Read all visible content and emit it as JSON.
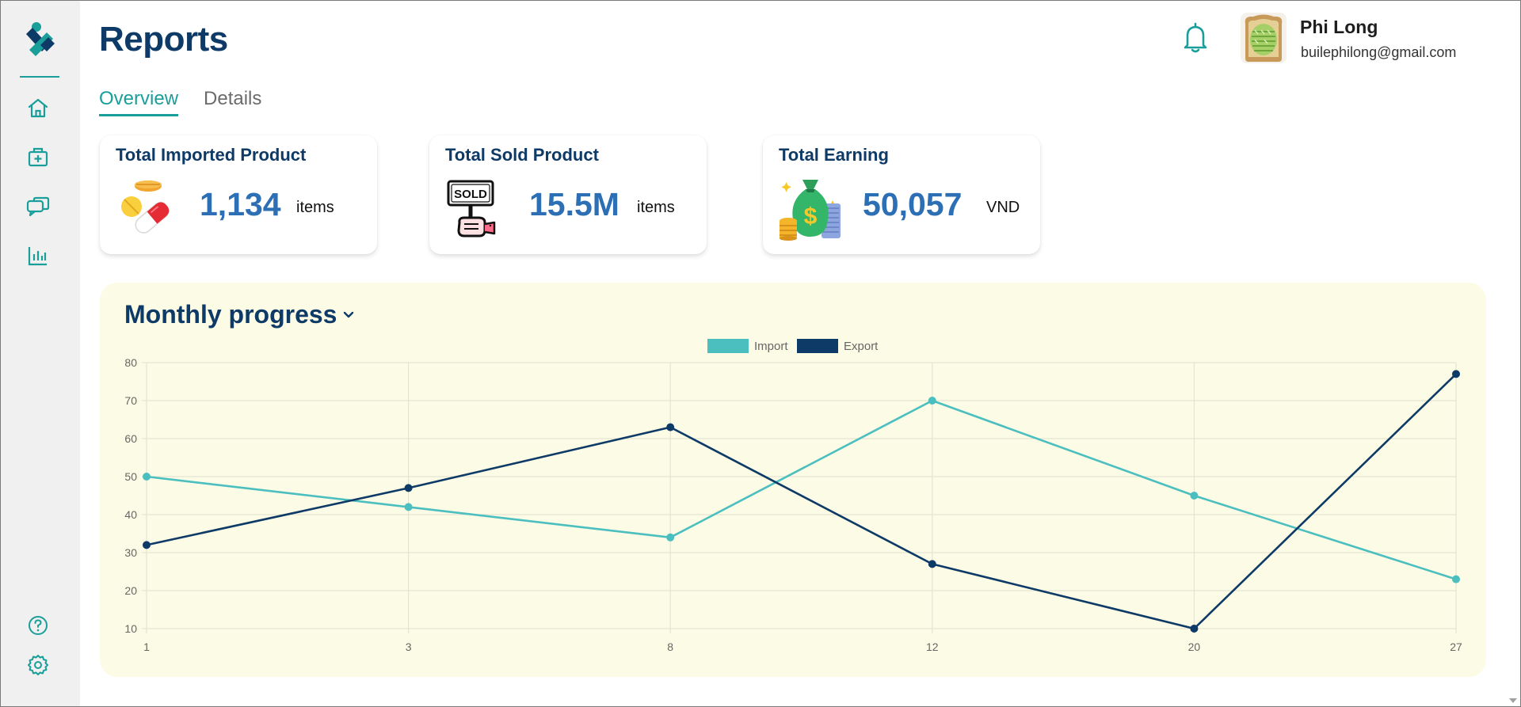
{
  "header": {
    "title": "Reports",
    "tabs": [
      {
        "label": "Overview",
        "active": true
      },
      {
        "label": "Details",
        "active": false
      }
    ],
    "user": {
      "name": "Phi Long",
      "email": "builephilong@gmail.com"
    }
  },
  "sidebar": {
    "items": [
      {
        "icon": "home-icon"
      },
      {
        "icon": "medical-bag-icon"
      },
      {
        "icon": "chat-icon"
      },
      {
        "icon": "bar-chart-icon"
      }
    ],
    "bottom": [
      {
        "icon": "help-icon"
      },
      {
        "icon": "settings-icon"
      }
    ]
  },
  "cards": [
    {
      "title": "Total Imported Product",
      "value": "1,134",
      "unit": "items",
      "icon": "pills-icon"
    },
    {
      "title": "Total Sold Product",
      "value": "15.5M",
      "unit": "items",
      "icon": "sold-sign-icon"
    },
    {
      "title": "Total Earning",
      "value": "50,057",
      "unit": "VND",
      "icon": "money-bag-icon"
    }
  ],
  "panel": {
    "title": "Monthly progress"
  },
  "colors": {
    "accent": "#1a9e9a",
    "navy": "#0d3a66",
    "import": "#4bbfbf",
    "export": "#0d3a66",
    "panel_bg": "#fcfbe5"
  },
  "chart_data": {
    "type": "line",
    "x": [
      "1",
      "3",
      "8",
      "12",
      "20",
      "27"
    ],
    "series": [
      {
        "name": "Import",
        "values": [
          50,
          42,
          34,
          70,
          45,
          23
        ],
        "color": "#4bbfbf"
      },
      {
        "name": "Export",
        "values": [
          32,
          47,
          63,
          27,
          10,
          77
        ],
        "color": "#0d3a66"
      }
    ],
    "ylim": [
      10,
      80
    ],
    "yticks": [
      10,
      20,
      30,
      40,
      50,
      60,
      70,
      80
    ],
    "grid": true,
    "legend": "top-center"
  }
}
